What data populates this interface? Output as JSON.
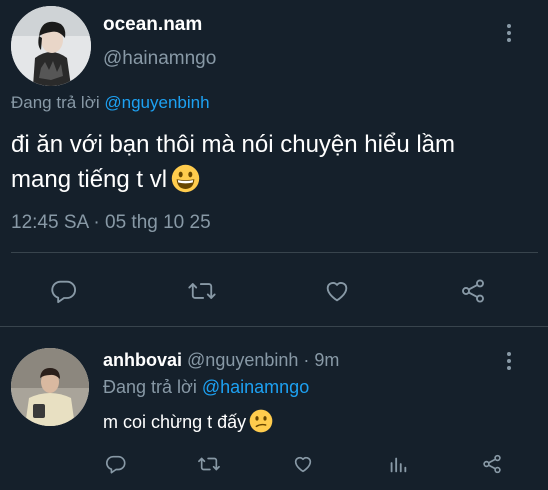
{
  "main_tweet": {
    "display_name": "ocean.nam",
    "handle": "@hainamngo",
    "replying_prefix": "Đang trả lời",
    "replying_to": "@nguyenbinh",
    "text_line1": "đi ăn với bạn thôi mà nói chuyện hiểu lầm",
    "text_line2": "mang tiếng t vl",
    "text_emoji": "grinning-face-emoji",
    "timestamp": "12:45 SA · 05 thg 10 25",
    "actions": [
      "reply-icon",
      "retweet-icon",
      "like-icon",
      "share-icon"
    ]
  },
  "reply_tweet": {
    "display_name": "anhbovai",
    "handle": "@nguyenbinh",
    "separator": "·",
    "time": "9m",
    "replying_prefix": "Đang trả lời",
    "replying_to": "@hainamngo",
    "text": "m coi chừng t đấy",
    "text_emoji": "confused-face-emoji",
    "actions": [
      "reply-icon",
      "retweet-icon",
      "like-icon",
      "analytics-icon",
      "share-icon"
    ]
  },
  "colors": {
    "background": "#15202b",
    "secondary_text": "#8899a6",
    "link": "#1da1f2",
    "divider": "#38444d"
  }
}
